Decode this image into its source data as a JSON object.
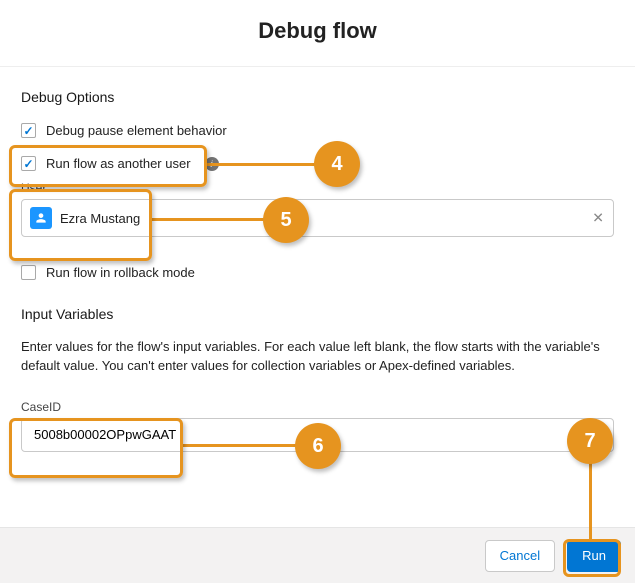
{
  "header": {
    "title": "Debug flow"
  },
  "debugOptions": {
    "section_title": "Debug Options",
    "pause_label": "Debug pause element behavior",
    "runas_label": "Run flow as another user",
    "user_field_label": "User",
    "user_value": "Ezra Mustang",
    "rollback_label": "Run flow in rollback mode"
  },
  "inputVariables": {
    "section_title": "Input Variables",
    "help_text": "Enter values for the flow's input variables. For each value left blank, the flow starts with the variable's default value. You can't enter values for collection variables or Apex-defined variables.",
    "caseid_label": "CaseID",
    "caseid_value": "5008b00002OPpwGAAT"
  },
  "footer": {
    "cancel_label": "Cancel",
    "run_label": "Run"
  },
  "callouts": {
    "b4": "4",
    "b5": "5",
    "b6": "6",
    "b7": "7"
  }
}
